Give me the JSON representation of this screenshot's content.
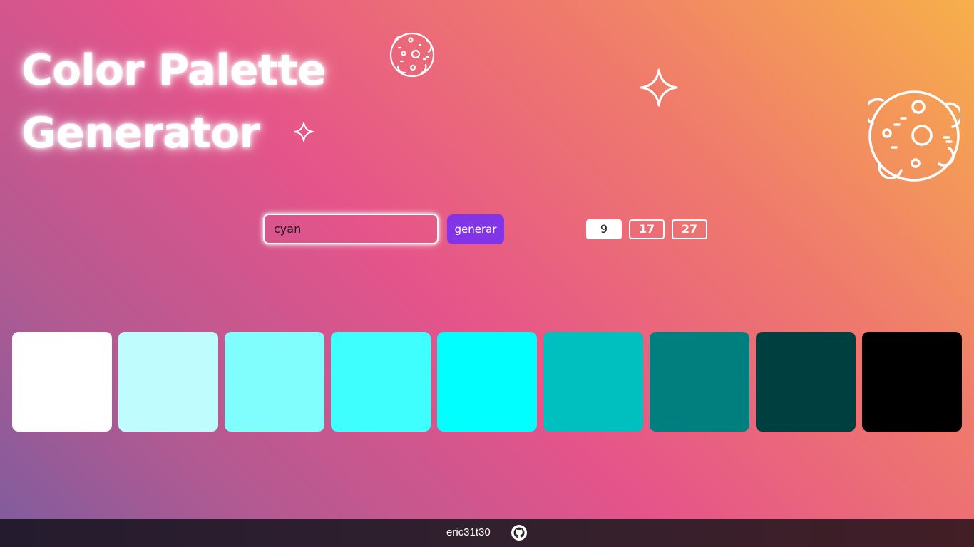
{
  "title": {
    "line1": "Color Palette",
    "line2": "Generator"
  },
  "decorations": [
    "moon-icon",
    "sparkle-icon",
    "moon-icon",
    "sparkle-icon"
  ],
  "form": {
    "input_value": "cyan",
    "generate_label": "generar",
    "accent_color": "#8235e6"
  },
  "counts": [
    {
      "label": "9",
      "active": true
    },
    {
      "label": "17",
      "active": false
    },
    {
      "label": "27",
      "active": false
    }
  ],
  "palette": {
    "colors": [
      "#ffffff",
      "#bffcfe",
      "#80fefe",
      "#3ffefe",
      "#00ffff",
      "#00bfbf",
      "#007f7f",
      "#003f3f",
      "#000000"
    ]
  },
  "footer": {
    "username": "eric31t30",
    "icon": "github-icon"
  }
}
